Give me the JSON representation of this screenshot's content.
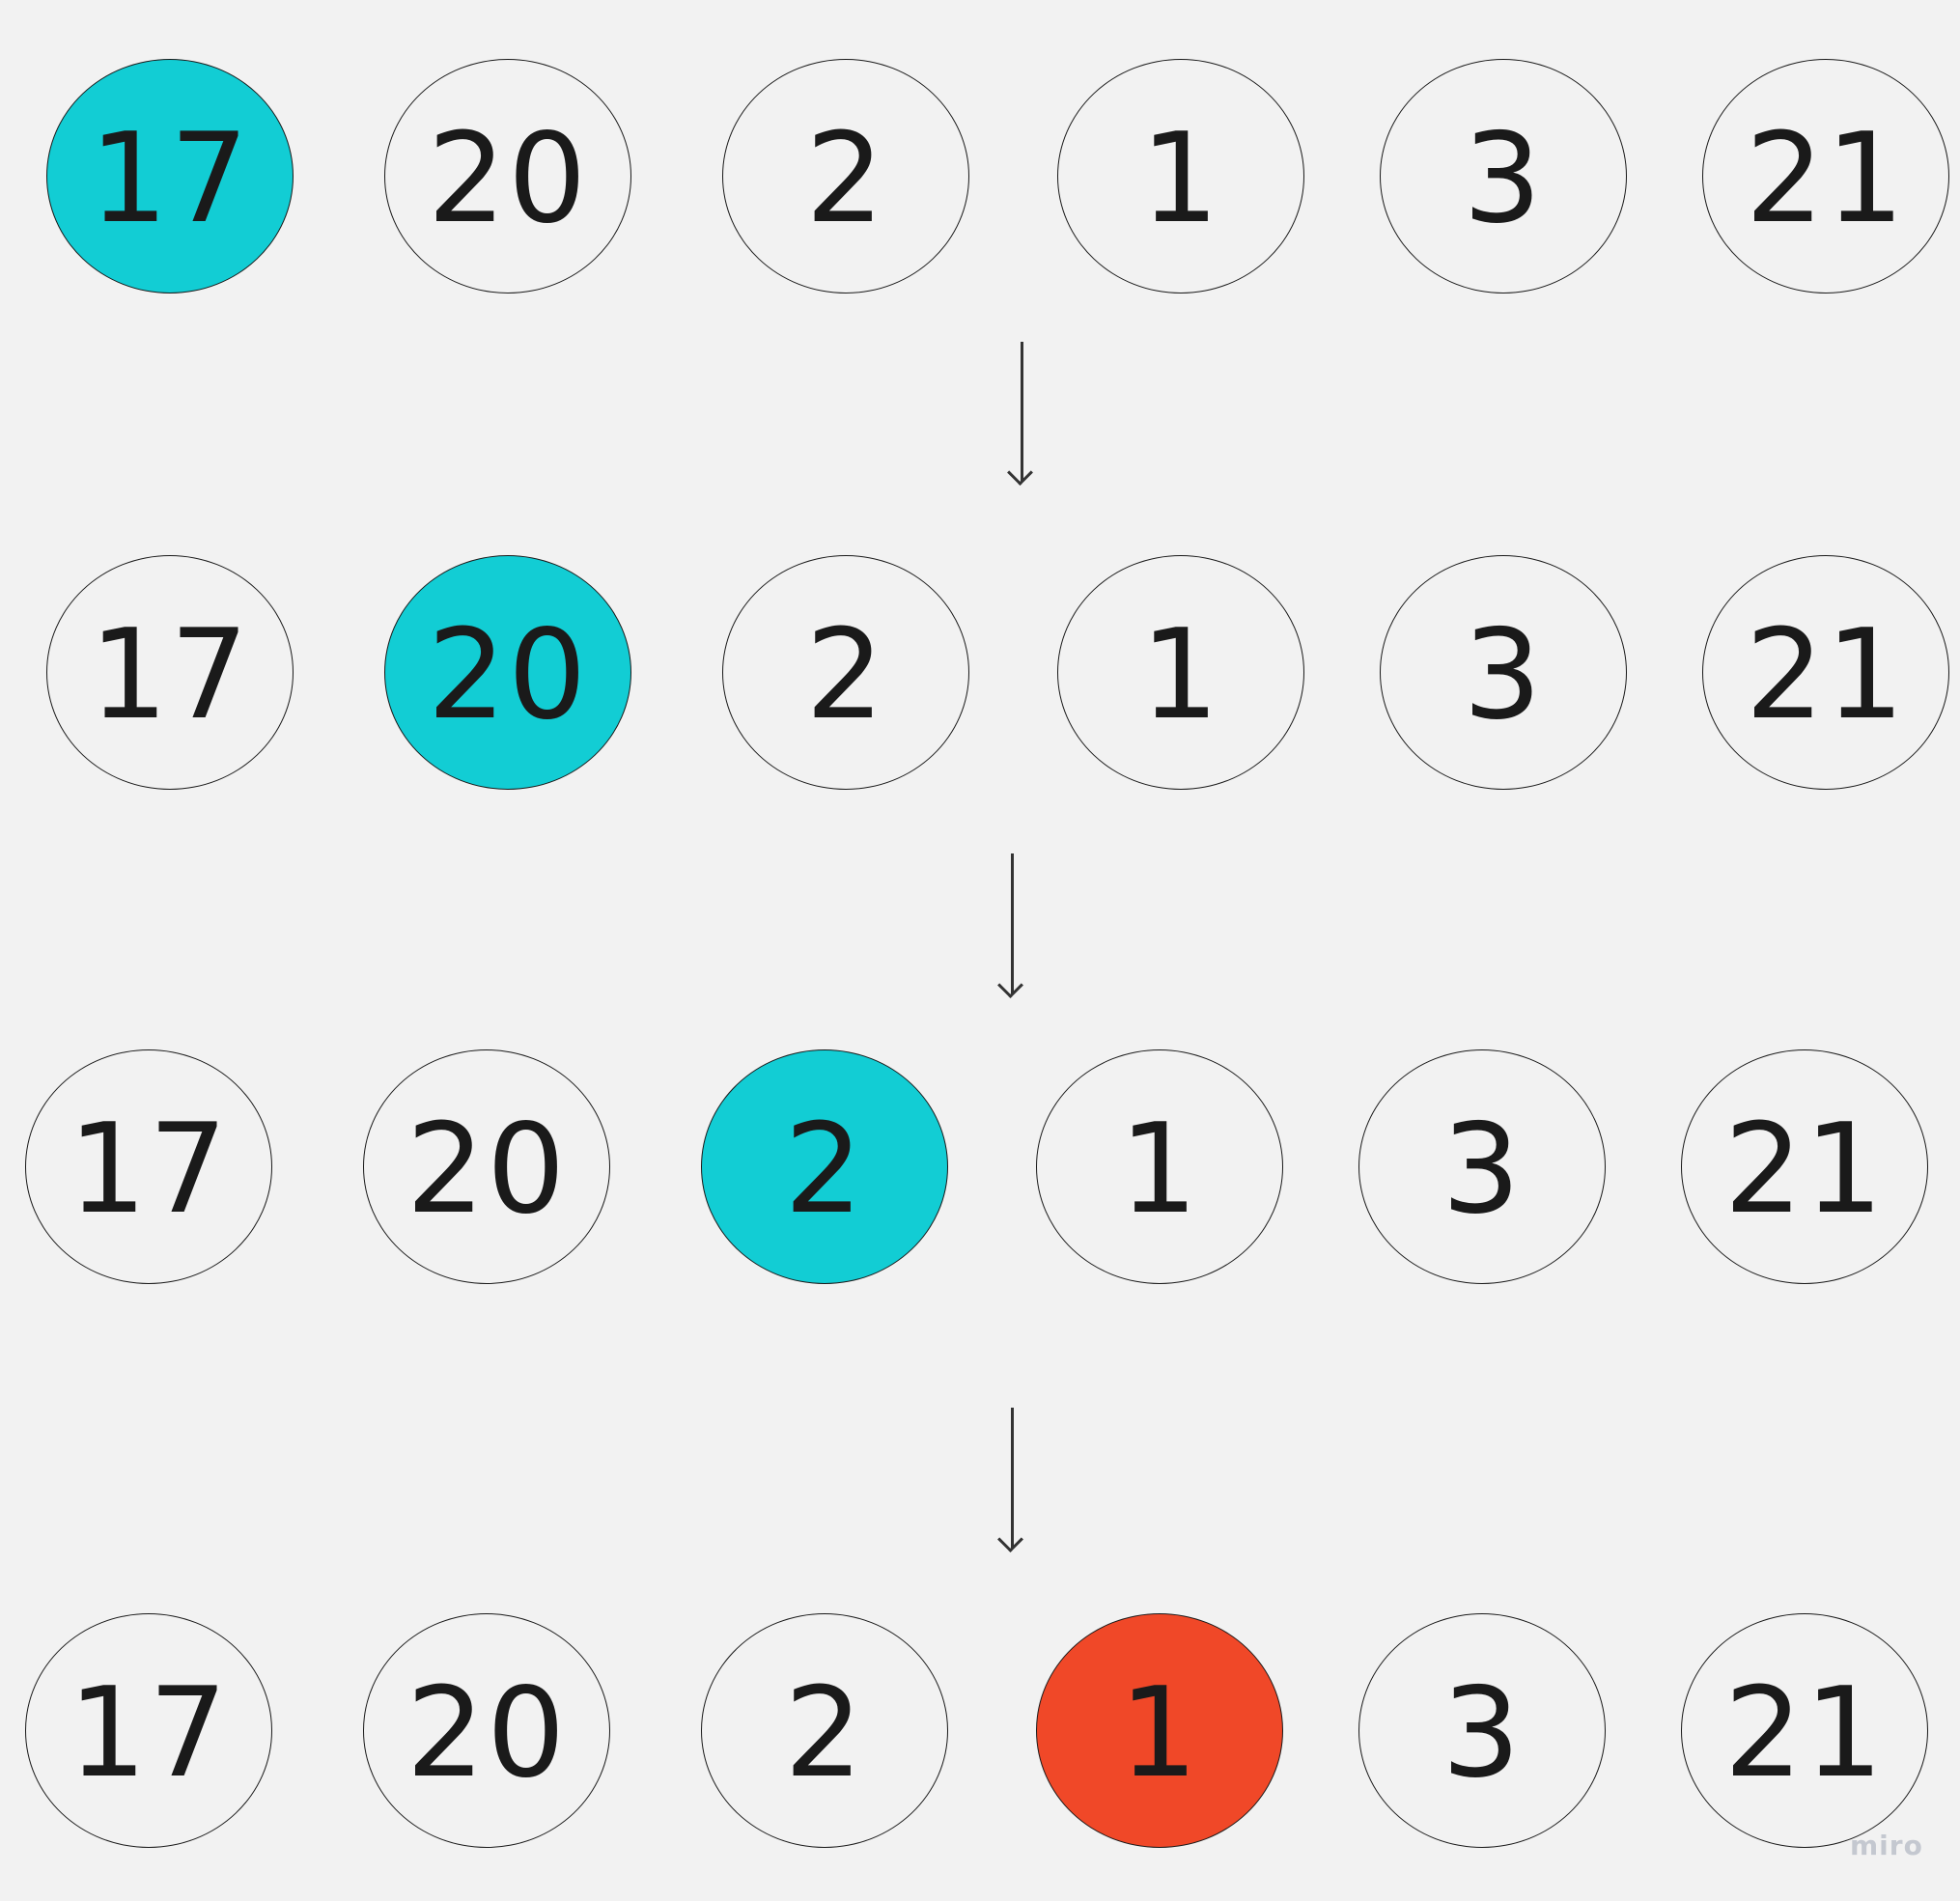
{
  "diagram": {
    "highlight_color": "#12cdd4",
    "target_color": "#f04828",
    "default_fill": "#f2f2f2",
    "steps": [
      {
        "values": [
          "17",
          "20",
          "2",
          "1",
          "3",
          "21"
        ],
        "highlighted_index": 0,
        "state": "current"
      },
      {
        "values": [
          "17",
          "20",
          "2",
          "1",
          "3",
          "21"
        ],
        "highlighted_index": 1,
        "state": "current"
      },
      {
        "values": [
          "17",
          "20",
          "2",
          "1",
          "3",
          "21"
        ],
        "highlighted_index": 2,
        "state": "current"
      },
      {
        "values": [
          "17",
          "20",
          "2",
          "1",
          "3",
          "21"
        ],
        "highlighted_index": 3,
        "state": "found"
      }
    ],
    "arrow_icon": "arrow-down-icon"
  },
  "watermark": "miro"
}
